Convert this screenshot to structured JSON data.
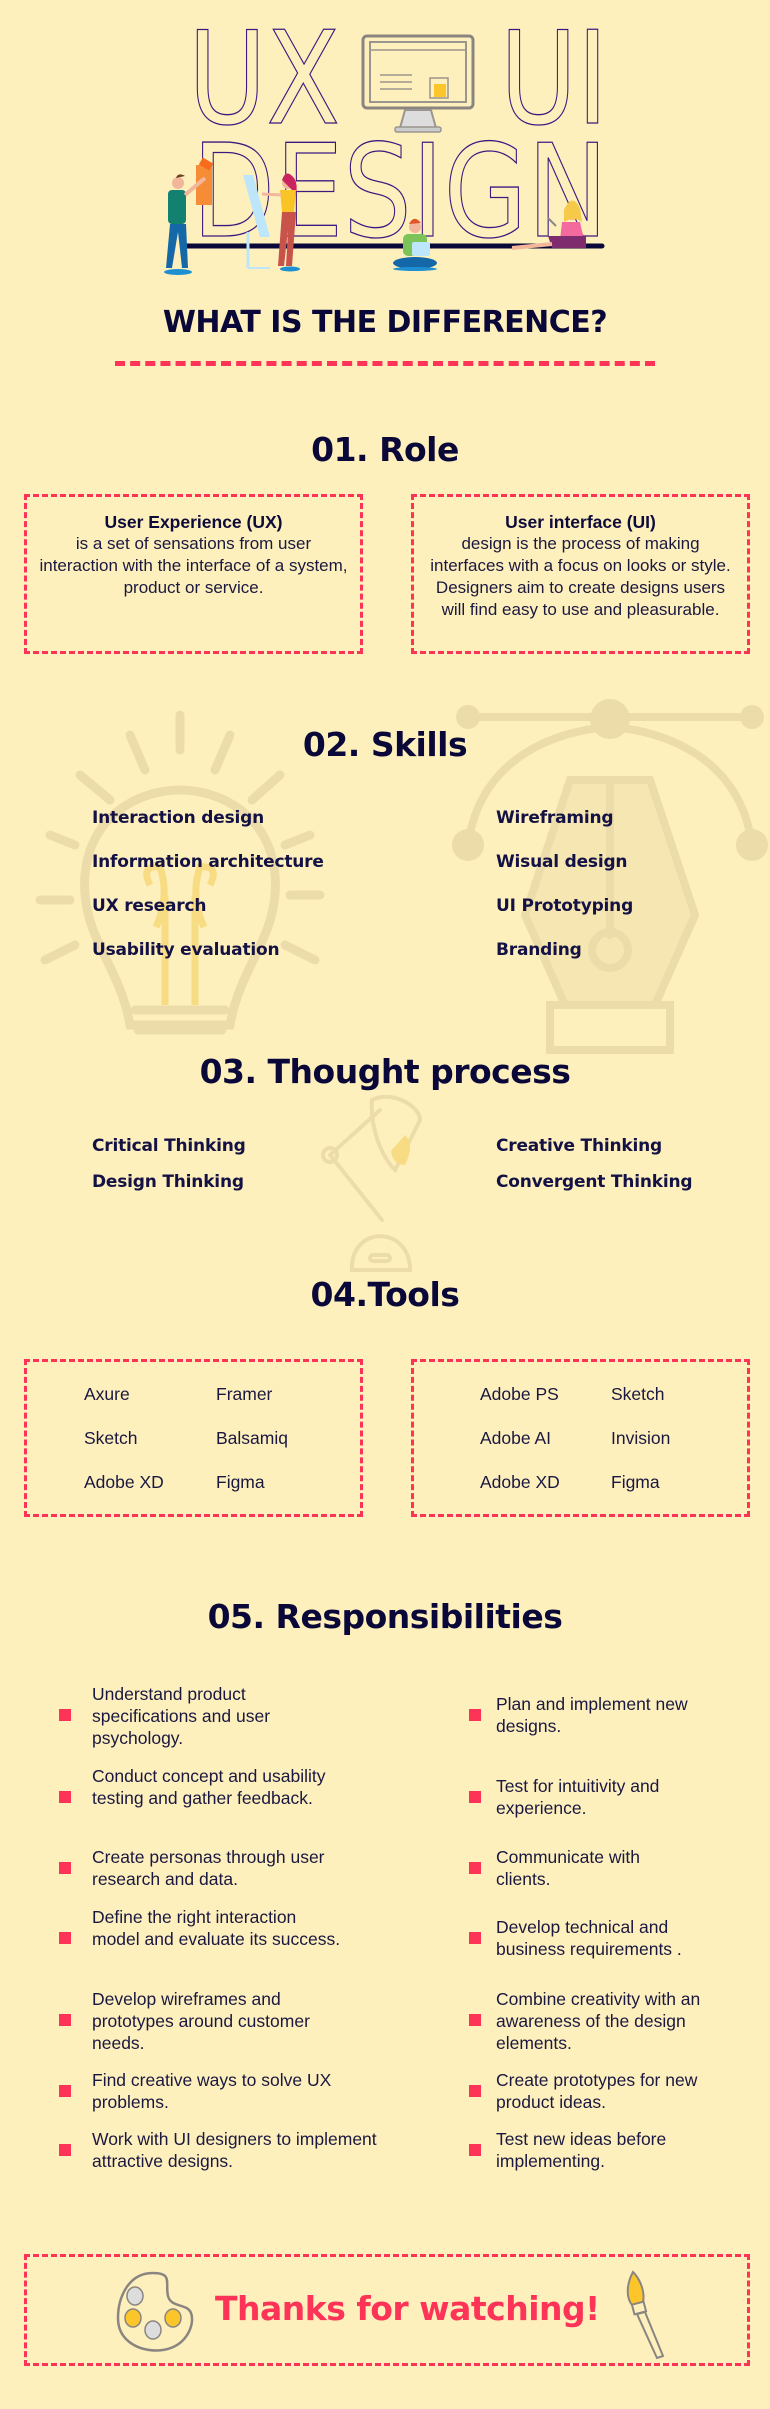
{
  "hero": {
    "line1_left": "UX",
    "line1_right": "UI",
    "line2": "DESIGN",
    "subtitle": "WHAT IS THE DIFFERENCE?"
  },
  "colors": {
    "background": "#fef0bd",
    "accent": "#fd3357",
    "heading": "#0a0838",
    "outline": "#3a1a80",
    "illustration": "#e8d9a8"
  },
  "role": {
    "heading": "01. Role",
    "ux": {
      "title": "User Experience (UX)",
      "body": "is a set of sensations from user interaction with the interface of a system, product or service."
    },
    "ui": {
      "title": "User interface (UI)",
      "body": "design is the process of making interfaces with a focus on looks or style. Designers aim to create designs users will find easy to use and pleasurable."
    }
  },
  "skills": {
    "heading": "02. Skills",
    "ux": [
      "Interaction design",
      "Information architecture",
      "UX research",
      "Usability evaluation"
    ],
    "ui": [
      "Wireframing",
      "Wisual design",
      "UI Prototyping",
      "Branding"
    ]
  },
  "thought": {
    "heading": "03. Thought process",
    "ux": [
      "Critical Thinking",
      "Design Thinking"
    ],
    "ui": [
      "Creative Thinking",
      "Convergent Thinking"
    ]
  },
  "tools": {
    "heading": "04.Tools",
    "ux": [
      "Axure",
      "Framer",
      "Sketch",
      "Balsamiq",
      "Adobe XD",
      "Figma"
    ],
    "ui": [
      "Adobe PS",
      "Sketch",
      "Adobe AI",
      "Invision",
      "Adobe XD",
      "Figma"
    ]
  },
  "responsibilities": {
    "heading": "05. Responsibilities",
    "ux": [
      "Understand product specifications and user psychology.",
      "Conduct concept and usability testing and gather feedback.",
      "Create personas through user research and data.",
      "Define the right interaction model and evaluate its success.",
      "Develop wireframes and prototypes around customer needs.",
      "Find creative ways to solve UX problems.",
      "Work with UI designers to implement attractive designs."
    ],
    "ui": [
      "Plan and implement new designs.",
      "Test for intuitivity and experience.",
      "Communicate with clients.",
      "Develop technical and business requirements .",
      "Combine creativity with an awareness of the design elements.",
      "Create prototypes for new product ideas.",
      "Test new ideas before implementing."
    ]
  },
  "footer": {
    "thanks": "Thanks for watching!"
  }
}
